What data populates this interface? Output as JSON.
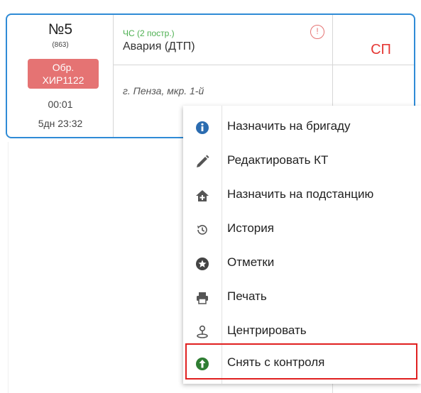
{
  "card": {
    "number": "№5",
    "sub_id": "(863)",
    "badge": "Обр.\nХИР1122",
    "time_elapsed": "00:01",
    "time_total": "5дн 23:32",
    "category": "ЧС (2 постр.)",
    "title": "Авария (ДТП)",
    "address": "г. Пенза, мкр. 1-й",
    "info_icon": "!",
    "status": "СП"
  },
  "colors": {
    "card_border": "#2f8bd6",
    "badge_bg": "#e57373",
    "category_green": "#4caf50",
    "status_red": "#e53935",
    "highlight_border": "#e02020"
  },
  "menu": {
    "items": [
      {
        "icon": "info-circle-icon",
        "label": "Назначить на бригаду"
      },
      {
        "icon": "pencil-icon",
        "label": "Редактировать КТ"
      },
      {
        "icon": "home-plus-icon",
        "label": "Назначить на подстанцию"
      },
      {
        "icon": "history-icon",
        "label": "История"
      },
      {
        "icon": "star-circle-icon",
        "label": "Отметки"
      },
      {
        "icon": "printer-icon",
        "label": "Печать"
      },
      {
        "icon": "map-pin-person-icon",
        "label": "Центрировать"
      },
      {
        "icon": "arrow-up-circle-icon",
        "label": "Снять с контроля"
      }
    ]
  }
}
